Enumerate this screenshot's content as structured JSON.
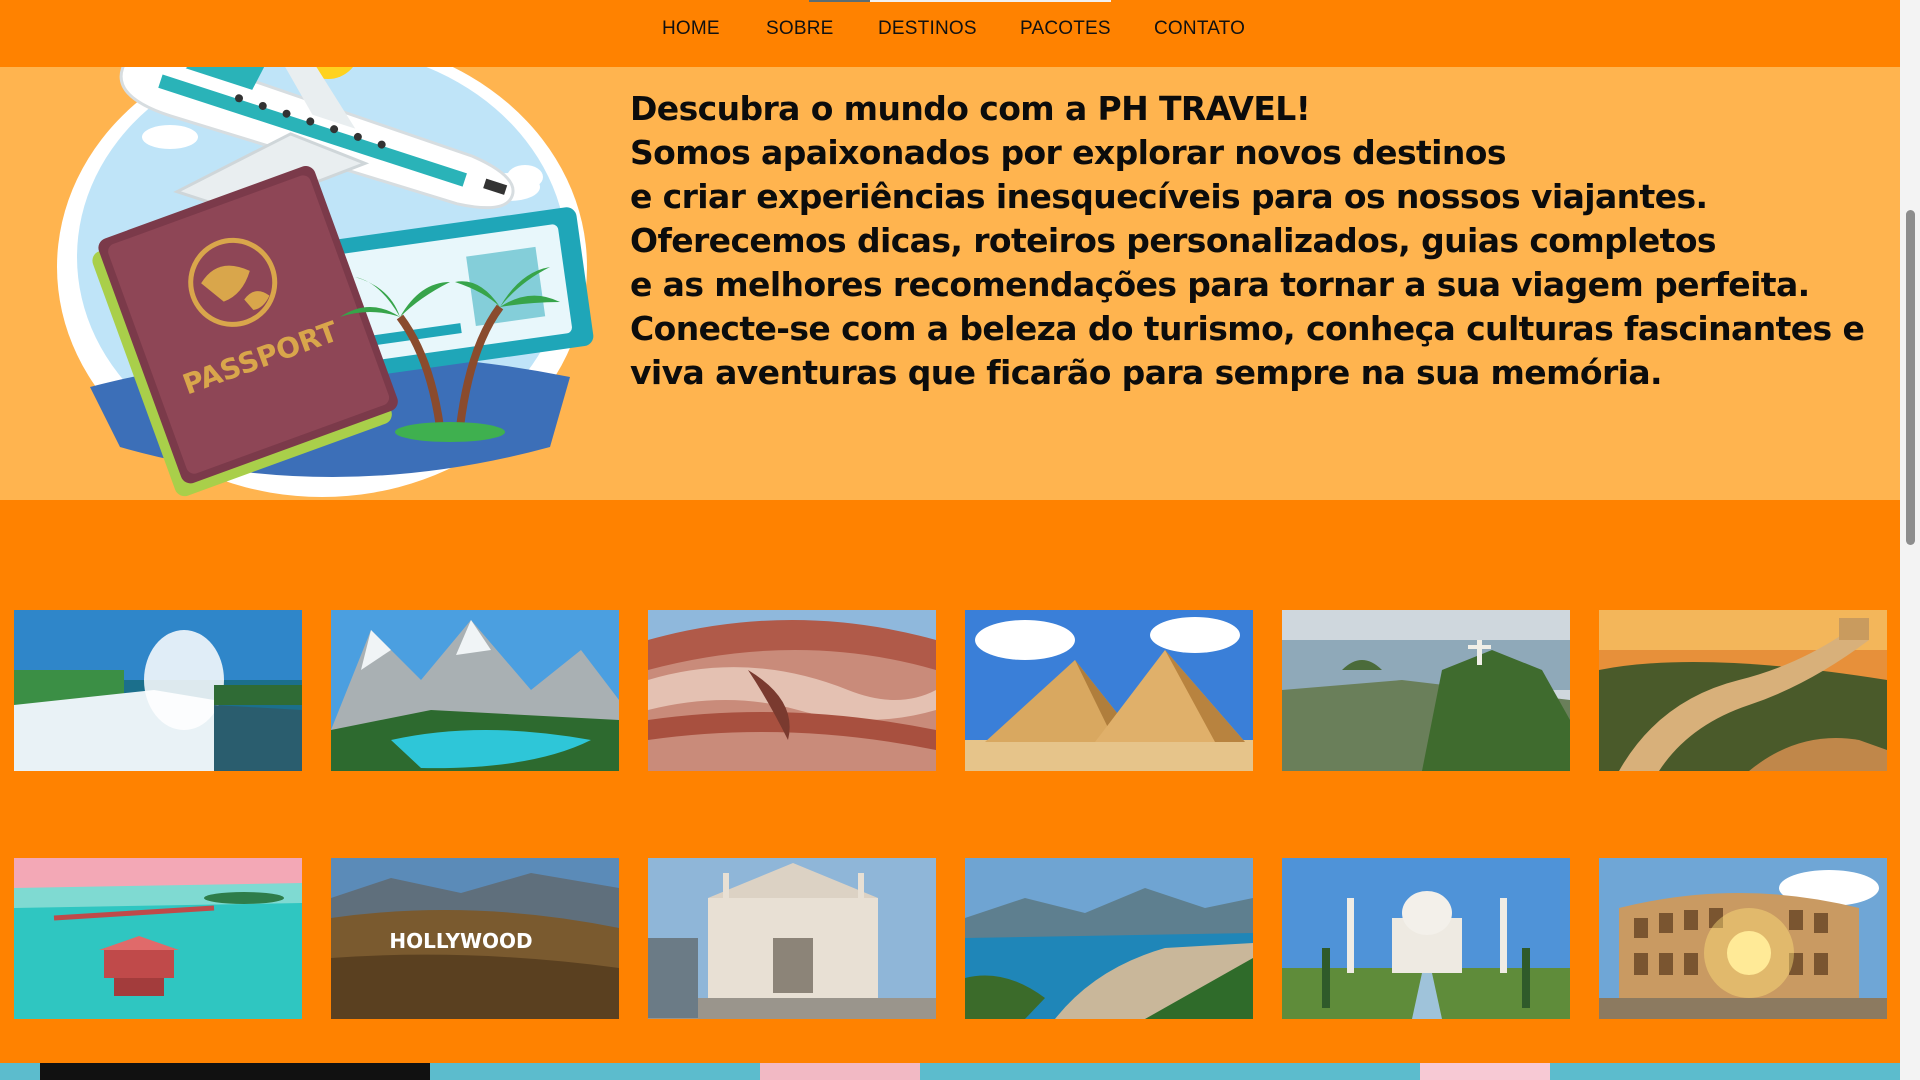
{
  "nav": {
    "items": [
      {
        "label": "HOME"
      },
      {
        "label": "SOBRE"
      },
      {
        "label": "DESTINOS"
      },
      {
        "label": "PACOTES"
      },
      {
        "label": "CONTATO"
      }
    ]
  },
  "about": {
    "lines": [
      "Descubra o mundo com a PH TRAVEL!",
      "Somos apaixonados por explorar novos destinos",
      "e criar experiências inesquecíveis para os nossos viajantes.",
      "Oferecemos dicas, roteiros personalizados, guias completos",
      "e as melhores recomendações para tornar a sua viagem perfeita.",
      "Conecte-se com a beleza do turismo, conheça culturas fascinantes e",
      "viva aventuras que ficarão para sempre na sua memória."
    ],
    "illustration": {
      "passport_text": "PASSPORT"
    }
  },
  "gallery": {
    "photos": [
      {
        "icon": "waterfall-photo"
      },
      {
        "icon": "mountain-lake-photo"
      },
      {
        "icon": "sandstone-canyon-photo"
      },
      {
        "icon": "pyramids-photo"
      },
      {
        "icon": "rio-christ-photo"
      },
      {
        "icon": "great-wall-photo"
      },
      {
        "icon": "overwater-bungalow-photo"
      },
      {
        "icon": "hollywood-sign-photo",
        "sign_text": "HOLLYWOOD"
      },
      {
        "icon": "milan-cathedral-photo"
      },
      {
        "icon": "copacabana-beach-photo"
      },
      {
        "icon": "taj-mahal-photo"
      },
      {
        "icon": "colosseum-photo"
      }
    ]
  },
  "colors": {
    "nav_bg": "#ff8200",
    "about_bg": "#ffb44f",
    "gallery_bg": "#ff8200"
  }
}
